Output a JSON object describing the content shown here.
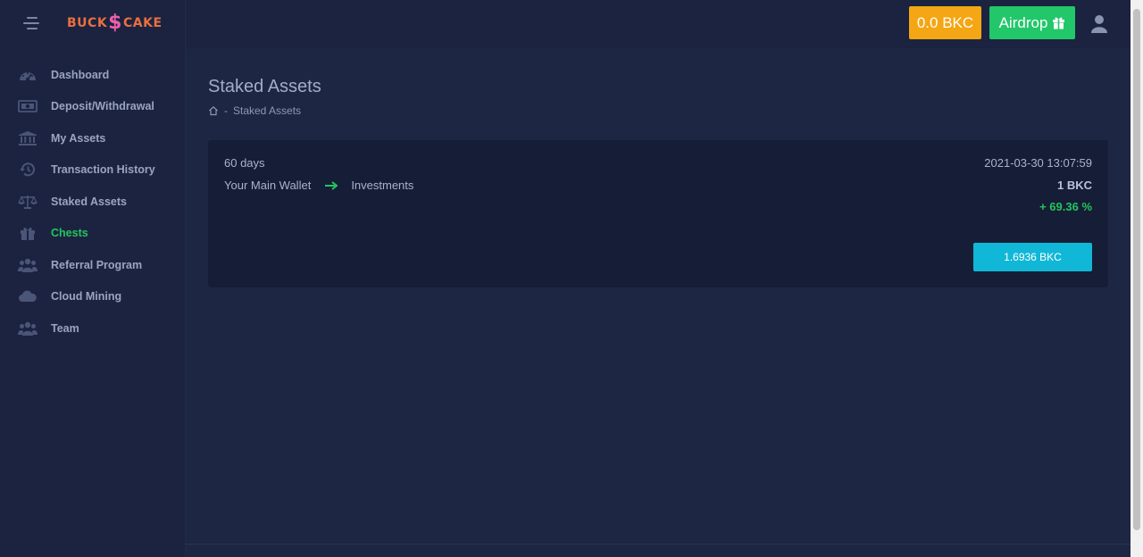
{
  "brand": {
    "logo_left": "BUCK",
    "logo_symbol": "$",
    "logo_right": "CAKE"
  },
  "sidebar": {
    "items": [
      {
        "label": "Dashboard",
        "icon": "dashboard-gauge-icon"
      },
      {
        "label": "Deposit/Withdrawal",
        "icon": "money-bill-icon"
      },
      {
        "label": "My Assets",
        "icon": "bank-building-icon"
      },
      {
        "label": "Transaction History",
        "icon": "history-icon"
      },
      {
        "label": "Staked Assets",
        "icon": "balance-scale-icon"
      },
      {
        "label": "Chests",
        "icon": "gift-icon",
        "active": true
      },
      {
        "label": "Referral Program",
        "icon": "users-icon"
      },
      {
        "label": "Cloud Mining",
        "icon": "cloud-icon"
      },
      {
        "label": "Team",
        "icon": "team-icon"
      }
    ]
  },
  "header": {
    "balance_label": "0.0 BKC",
    "airdrop_label": "Airdrop"
  },
  "page": {
    "title": "Staked Assets",
    "breadcrumb_current": "Staked Assets",
    "breadcrumb_sep": "-"
  },
  "stake": {
    "duration": "60 days",
    "from": "Your Main Wallet",
    "to": "Investments",
    "date": "2021-03-30 13:07:59",
    "amount": "1 BKC",
    "percent": "+ 69.36 %",
    "payout_button": "1.6936 BKC"
  },
  "colors": {
    "background": "#1d2744",
    "sidebar": "#1b2340",
    "card": "#161d36",
    "active": "#22c55e",
    "balance_btn": "#f5a614",
    "airdrop_btn": "#22c76a",
    "payout_btn": "#11b7d6"
  }
}
